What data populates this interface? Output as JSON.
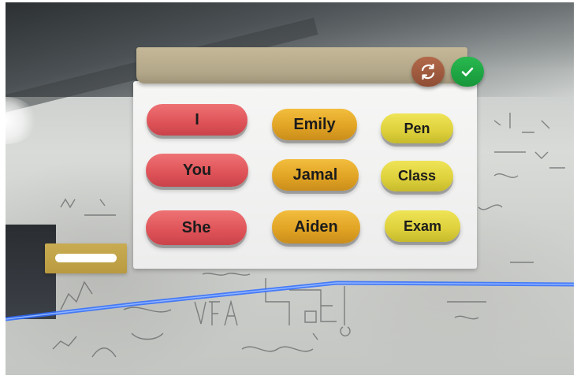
{
  "words": {
    "pronouns": [
      "I",
      "You",
      "She"
    ],
    "names": [
      "Emily",
      "Jamal",
      "Aiden"
    ],
    "nouns": [
      "Pen",
      "Class",
      "Exam"
    ]
  },
  "icons": {
    "refresh": "refresh-icon",
    "confirm": "checkmark-icon"
  },
  "colors": {
    "pronoun_tile": "#de5257",
    "name_tile": "#e0a223",
    "noun_tile": "#ddd03b",
    "answer_bar": "#b3a789",
    "refresh_button": "#9e5a3f",
    "confirm_button": "#1fa844",
    "floor_line": "#2f6cff",
    "side_tab": "#c2a34a"
  }
}
